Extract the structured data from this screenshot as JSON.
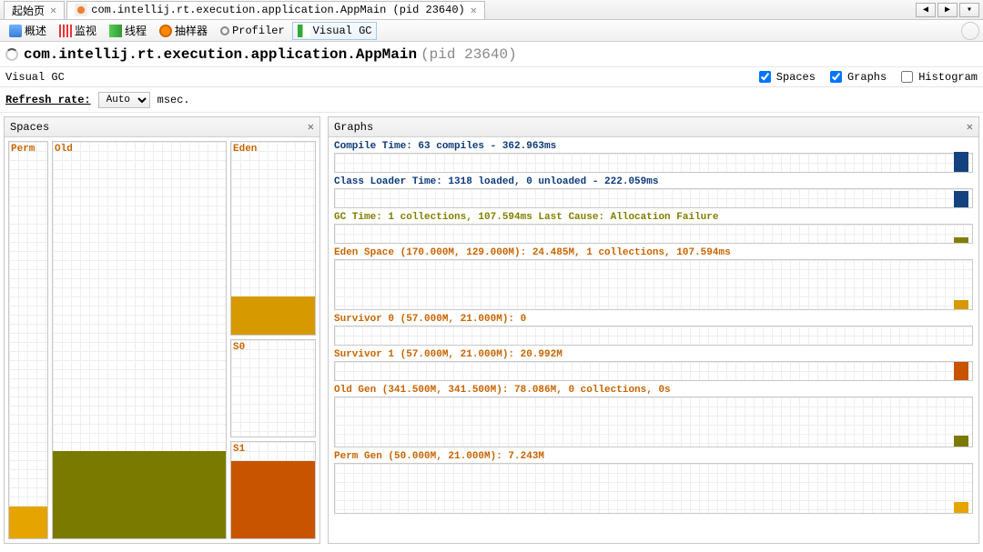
{
  "tabs": {
    "start_page": "起始页",
    "app_tab": "com.intellij.rt.execution.application.AppMain (pid 23640)"
  },
  "toolbar": {
    "overview": "概述",
    "monitor": "监视",
    "threads": "线程",
    "sampler": "抽样器",
    "profiler": "Profiler",
    "visualgc": "Visual GC"
  },
  "title": {
    "main": "com.intellij.rt.execution.application.AppMain",
    "pid": "(pid 23640)"
  },
  "subheader": {
    "label": "Visual GC",
    "spaces": "Spaces",
    "graphs": "Graphs",
    "histogram": "Histogram"
  },
  "refresh": {
    "label": "Refresh rate:",
    "value": "Auto",
    "unit": "msec."
  },
  "panes": {
    "spaces": "Spaces",
    "graphs": "Graphs"
  },
  "spaces": {
    "perm": {
      "label": "Perm",
      "color": "#e6a400",
      "fill_pct": 8
    },
    "old": {
      "label": "Old",
      "color": "#7a7a00",
      "fill_pct": 22
    },
    "eden": {
      "label": "Eden",
      "color": "#d69a00",
      "fill_pct": 20
    },
    "s0": {
      "label": "S0",
      "color": "#d69a00",
      "fill_pct": 0
    },
    "s1": {
      "label": "S1",
      "color": "#c85400",
      "fill_pct": 80
    }
  },
  "graphs": [
    {
      "label": "Compile Time: 63 compiles - 362.963ms",
      "cls": "c-navy",
      "blip_h": 22,
      "blip_c": "#14427e",
      "h": "med"
    },
    {
      "label": "Class Loader Time: 1318 loaded, 0 unloaded - 222.059ms",
      "cls": "c-navy",
      "blip_h": 18,
      "blip_c": "#14427e",
      "h": "med"
    },
    {
      "label": "GC Time: 1 collections, 107.594ms Last Cause: Allocation Failure",
      "cls": "c-olive",
      "blip_h": 6,
      "blip_c": "#808000",
      "h": "med"
    },
    {
      "label": "Eden Space (170.000M, 129.000M): 24.485M, 1 collections, 107.594ms",
      "cls": "c-orange",
      "blip_h": 10,
      "blip_c": "#d69a00",
      "h": "tall"
    },
    {
      "label": "Survivor 0 (57.000M, 21.000M): 0",
      "cls": "c-orange",
      "blip_h": 0,
      "blip_c": "#d69a00",
      "h": "med"
    },
    {
      "label": "Survivor 1 (57.000M, 21.000M): 20.992M",
      "cls": "c-orange",
      "blip_h": 20,
      "blip_c": "#c85400",
      "h": "med"
    },
    {
      "label": "Old Gen (341.500M, 341.500M): 78.086M, 0 collections, 0s",
      "cls": "c-orange",
      "blip_h": 12,
      "blip_c": "#7a7a00",
      "h": "tall"
    },
    {
      "label": "Perm Gen (50.000M, 21.000M): 7.243M",
      "cls": "c-orange",
      "blip_h": 12,
      "blip_c": "#e6a400",
      "h": "tall"
    }
  ],
  "chart_data": {
    "type": "bar",
    "title": "JVM Memory Spaces (Visual GC snapshot)",
    "series": [
      {
        "name": "Perm Gen",
        "capacity_mb": 50.0,
        "committed_mb": 21.0,
        "used_mb": 7.243
      },
      {
        "name": "Old Gen",
        "capacity_mb": 341.5,
        "committed_mb": 341.5,
        "used_mb": 78.086,
        "collections": 0,
        "time_ms": 0
      },
      {
        "name": "Eden",
        "capacity_mb": 170.0,
        "committed_mb": 129.0,
        "used_mb": 24.485,
        "collections": 1,
        "time_ms": 107.594
      },
      {
        "name": "Survivor 0",
        "capacity_mb": 57.0,
        "committed_mb": 21.0,
        "used_mb": 0
      },
      {
        "name": "Survivor 1",
        "capacity_mb": 57.0,
        "committed_mb": 21.0,
        "used_mb": 20.992
      }
    ],
    "timers": {
      "compile": {
        "count": 63,
        "time_ms": 362.963
      },
      "class_loader": {
        "loaded": 1318,
        "unloaded": 0,
        "time_ms": 222.059
      },
      "gc": {
        "collections": 1,
        "time_ms": 107.594,
        "last_cause": "Allocation Failure"
      }
    }
  }
}
